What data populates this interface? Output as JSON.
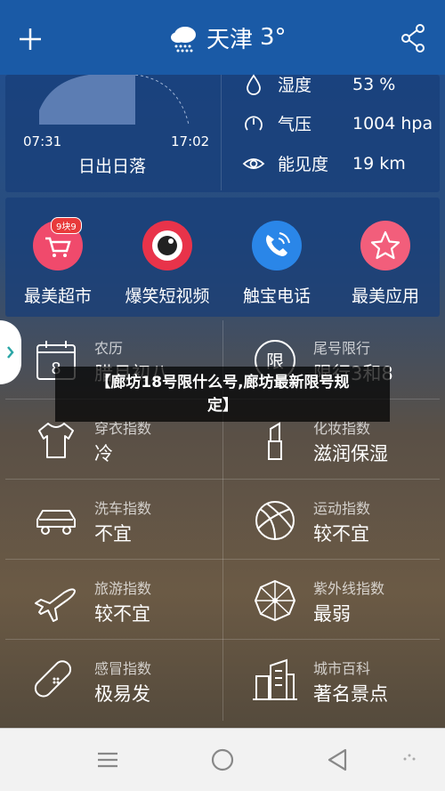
{
  "header": {
    "city": "天津",
    "temp": "3°"
  },
  "sun": {
    "sunrise": "07:31",
    "sunset": "17:02",
    "label": "日出日落"
  },
  "stats": [
    {
      "icon": "drop-icon",
      "label": "湿度",
      "value": "53 %"
    },
    {
      "icon": "gauge-icon",
      "label": "气压",
      "value": "1004 hpa"
    },
    {
      "icon": "eye-icon",
      "label": "能见度",
      "value": "19 km"
    }
  ],
  "apps": [
    {
      "icon": "cart-icon",
      "label": "最美超市",
      "badge": "9块9",
      "color": "#f04a6c"
    },
    {
      "icon": "camera-icon",
      "label": "爆笑短视频",
      "color": "#e8334a"
    },
    {
      "icon": "phone-icon",
      "label": "触宝电话",
      "color": "#2a86e8"
    },
    {
      "icon": "star-icon",
      "label": "最美应用",
      "color": "#f25e7b"
    }
  ],
  "grid": [
    {
      "icon": "calendar-icon",
      "name": "农历",
      "value": "腊月初八"
    },
    {
      "icon": "limit-icon",
      "name": "尾号限行",
      "value": "限行3和8"
    },
    {
      "icon": "shirt-icon",
      "name": "穿衣指数",
      "value": "冷"
    },
    {
      "icon": "lipstick-icon",
      "name": "化妆指数",
      "value": "滋润保湿"
    },
    {
      "icon": "car-icon",
      "name": "洗车指数",
      "value": "不宜"
    },
    {
      "icon": "ball-icon",
      "name": "运动指数",
      "value": "较不宜"
    },
    {
      "icon": "plane-icon",
      "name": "旅游指数",
      "value": "较不宜"
    },
    {
      "icon": "umbrella-icon",
      "name": "紫外线指数",
      "value": "最弱"
    },
    {
      "icon": "bandage-icon",
      "name": "感冒指数",
      "value": "极易发"
    },
    {
      "icon": "buildings-icon",
      "name": "城市百科",
      "value": "著名景点"
    }
  ],
  "overlay": {
    "line1": "【廊坊18号限什么号,廊坊最新限号规",
    "line2": "定】"
  },
  "limit_glyph": "限",
  "calendar_day": "8"
}
